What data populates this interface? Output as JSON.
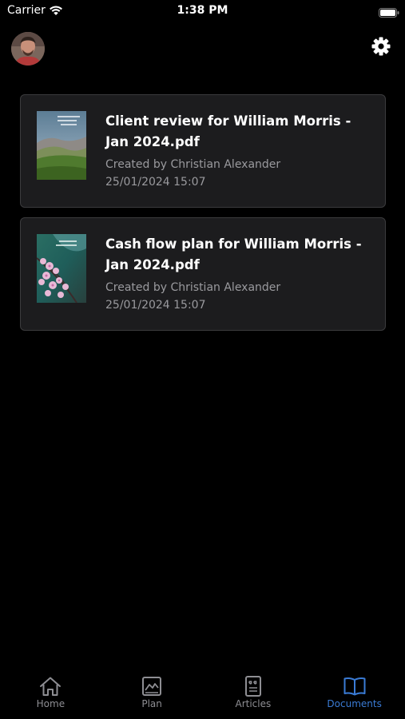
{
  "status_bar": {
    "carrier": "Carrier",
    "time": "1:38 PM"
  },
  "header": {
    "avatar_icon": "user-avatar",
    "settings_icon": "gear-icon"
  },
  "documents": [
    {
      "title": "Client review for William Morris - Jan 2024.pdf",
      "created_by": "Created by Christian Alexander",
      "date": "25/01/2024 15:07",
      "thumbnail_icon": "document-thumbnail-landscape"
    },
    {
      "title": "Cash flow plan for William Morris - Jan 2024.pdf",
      "created_by": "Created by Christian Alexander",
      "date": "25/01/2024 15:07",
      "thumbnail_icon": "document-thumbnail-blossom"
    }
  ],
  "tabs": [
    {
      "label": "Home",
      "icon": "home-icon",
      "active": false
    },
    {
      "label": "Plan",
      "icon": "chart-icon",
      "active": false
    },
    {
      "label": "Articles",
      "icon": "articles-icon",
      "active": false
    },
    {
      "label": "Documents",
      "icon": "book-icon",
      "active": true
    }
  ],
  "colors": {
    "background": "#000000",
    "card_background": "#1c1c1e",
    "card_border": "#3b3b3d",
    "secondary_text": "#9a9a9e",
    "tab_inactive": "#8e8e93",
    "tab_active": "#3a7bd5"
  }
}
